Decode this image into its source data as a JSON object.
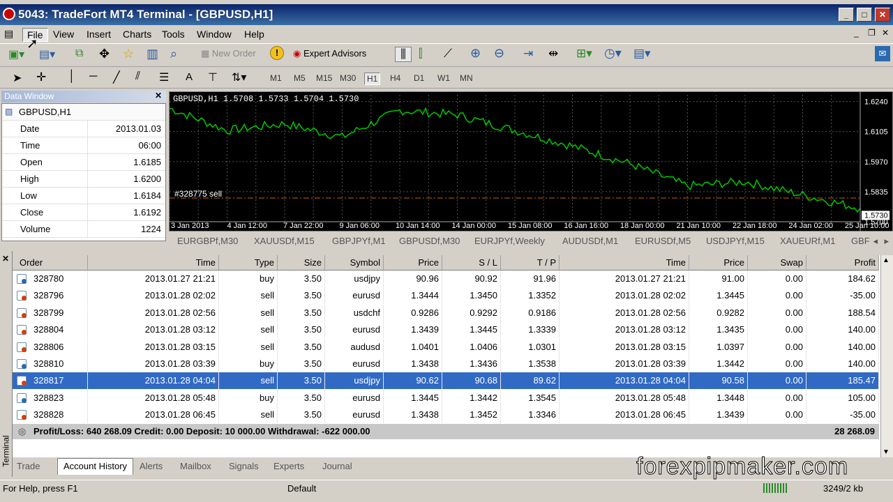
{
  "window": {
    "title": "5043: TradeFort MT4 Terminal - [GBPUSD,H1]"
  },
  "menu": [
    "File",
    "View",
    "Insert",
    "Charts",
    "Tools",
    "Window",
    "Help"
  ],
  "toolbar": {
    "new_order": "New Order",
    "expert_advisors": "Expert Advisors"
  },
  "timeframes": [
    "M1",
    "M5",
    "M15",
    "M30",
    "H1",
    "H4",
    "D1",
    "W1",
    "MN"
  ],
  "data_window": {
    "title": "Data Window",
    "symbol": "GBPUSD,H1",
    "rows": [
      {
        "k": "Date",
        "v": "2013.01.03"
      },
      {
        "k": "Time",
        "v": "06:00"
      },
      {
        "k": "Open",
        "v": "1.6185"
      },
      {
        "k": "High",
        "v": "1.6200"
      },
      {
        "k": "Low",
        "v": "1.6184"
      },
      {
        "k": "Close",
        "v": "1.6192"
      },
      {
        "k": "Volume",
        "v": "1224"
      }
    ]
  },
  "chart": {
    "header": "GBPUSD,H1  1.5708  1.5733  1.5704  1.5730",
    "order_label": "#328775 sell",
    "price_labels": [
      "1.6240",
      "1.6105",
      "1.5970",
      "1.5835",
      "1.5730",
      "1.5700"
    ],
    "date_labels": [
      "3 Jan 2013",
      "4 Jan 12:00",
      "7 Jan 22:00",
      "9 Jan 06:00",
      "10 Jan 14:00",
      "14 Jan 00:00",
      "15 Jan 08:00",
      "16 Jan 16:00",
      "18 Jan 00:00",
      "21 Jan 10:00",
      "22 Jan 18:00",
      "24 Jan 02:00",
      "25 Jan 10:00"
    ]
  },
  "chart_data": {
    "type": "line",
    "title": "GBPUSD,H1",
    "x": [
      "3 Jan 2013",
      "4 Jan 12:00",
      "7 Jan 22:00",
      "9 Jan 06:00",
      "10 Jan 14:00",
      "14 Jan 00:00",
      "15 Jan 08:00",
      "16 Jan 16:00",
      "18 Jan 00:00",
      "21 Jan 10:00",
      "22 Jan 18:00",
      "24 Jan 02:00",
      "25 Jan 10:00"
    ],
    "series": [
      {
        "values": [
          1.621,
          1.611,
          1.614,
          1.608,
          1.62,
          1.618,
          1.611,
          1.604,
          1.596,
          1.586,
          1.588,
          1.582,
          1.576
        ]
      }
    ],
    "ylim": [
      1.57,
      1.627
    ],
    "yticks": [
      1.624,
      1.6105,
      1.597,
      1.5835,
      1.57
    ],
    "current": 1.573
  },
  "chart_tabs": [
    "EURGBPf,M30",
    "XAUUSDf,M15",
    "GBPJPYf,M1",
    "GBPUSDf,M30",
    "EURJPYf,Weekly",
    "AUDUSDf,M1",
    "EURUSDf,M5",
    "USDJPYf,M15",
    "XAUEURf,M1",
    "GBF"
  ],
  "terminal_label": "Terminal",
  "table": {
    "headers": [
      "Order",
      "Time",
      "Type",
      "Size",
      "Symbol",
      "Price",
      "S / L",
      "T / P",
      "Time",
      "Price",
      "Swap",
      "Profit"
    ],
    "rows": [
      [
        "328780",
        "2013.01.27 21:21",
        "buy",
        "3.50",
        "usdjpy",
        "90.96",
        "90.92",
        "91.96",
        "2013.01.27 21:21",
        "91.00",
        "0.00",
        "184.62"
      ],
      [
        "328796",
        "2013.01.28 02:02",
        "sell",
        "3.50",
        "eurusd",
        "1.3444",
        "1.3450",
        "1.3352",
        "2013.01.28 02:02",
        "1.3445",
        "0.00",
        "-35.00"
      ],
      [
        "328799",
        "2013.01.28 02:56",
        "sell",
        "3.50",
        "usdchf",
        "0.9286",
        "0.9292",
        "0.9186",
        "2013.01.28 02:56",
        "0.9282",
        "0.00",
        "188.54"
      ],
      [
        "328804",
        "2013.01.28 03:12",
        "sell",
        "3.50",
        "eurusd",
        "1.3439",
        "1.3445",
        "1.3339",
        "2013.01.28 03:12",
        "1.3435",
        "0.00",
        "140.00"
      ],
      [
        "328806",
        "2013.01.28 03:15",
        "sell",
        "3.50",
        "audusd",
        "1.0401",
        "1.0406",
        "1.0301",
        "2013.01.28 03:15",
        "1.0397",
        "0.00",
        "140.00"
      ],
      [
        "328810",
        "2013.01.28 03:39",
        "buy",
        "3.50",
        "eurusd",
        "1.3438",
        "1.3436",
        "1.3538",
        "2013.01.28 03:39",
        "1.3442",
        "0.00",
        "140.00"
      ],
      [
        "328817",
        "2013.01.28 04:04",
        "sell",
        "3.50",
        "usdjpy",
        "90.62",
        "90.68",
        "89.62",
        "2013.01.28 04:04",
        "90.58",
        "0.00",
        "185.47"
      ],
      [
        "328823",
        "2013.01.28 05:48",
        "buy",
        "3.50",
        "eurusd",
        "1.3445",
        "1.3442",
        "1.3545",
        "2013.01.28 05:48",
        "1.3448",
        "0.00",
        "105.00"
      ],
      [
        "328828",
        "2013.01.28 06:45",
        "sell",
        "3.50",
        "eurusd",
        "1.3438",
        "1.3452",
        "1.3346",
        "2013.01.28 06:45",
        "1.3439",
        "0.00",
        "-35.00"
      ]
    ],
    "selected_index": 6,
    "summary": "Profit/Loss: 640 268.09  Credit: 0.00  Deposit: 10 000.00  Withdrawal: -622 000.00",
    "summary_total": "28 268.09"
  },
  "bottom_tabs": [
    "Trade",
    "Account History",
    "Alerts",
    "Mailbox",
    "Signals",
    "Experts",
    "Journal"
  ],
  "active_bottom_tab": "Account History",
  "status": {
    "help": "For Help, press F1",
    "profile": "Default",
    "traffic": "3249/2 kb"
  },
  "watermark": "forexpipmaker.com",
  "colors": {
    "chart_bg": "#000000",
    "line": "#00c800",
    "selected_row": "#316ac5",
    "order_line": "#c86400"
  }
}
